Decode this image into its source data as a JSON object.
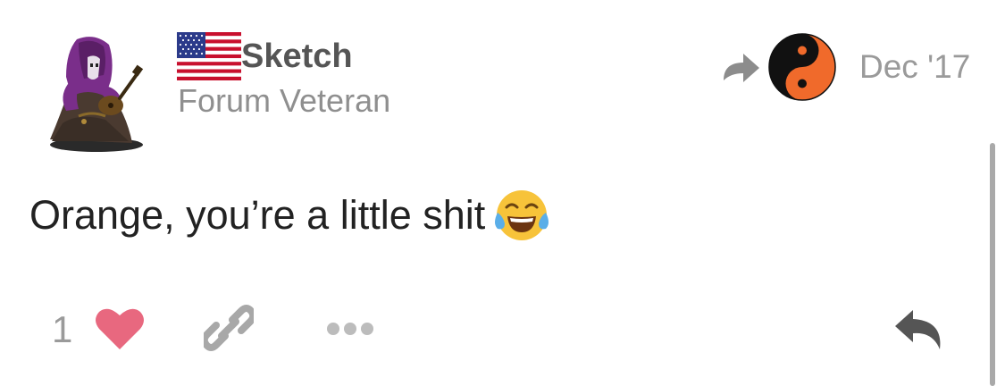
{
  "post": {
    "author": {
      "username": "Sketch",
      "title": "Forum Veteran",
      "flag_icon": "us-flag-icon",
      "avatar_icon": "hooded-bard-avatar"
    },
    "reply_to": {
      "arrow_icon": "reply-to-arrow-icon",
      "avatar_icon": "yin-yang-orange-avatar"
    },
    "date": "Dec '17",
    "body_text": "Orange, you’re a little shit",
    "body_emoji": "joy-emoji"
  },
  "actions": {
    "like_count": "1",
    "like_icon": "heart-icon",
    "link_icon": "link-icon",
    "more_icon": "ellipsis-icon",
    "reply_icon": "reply-icon"
  },
  "colors": {
    "heart": "#e8687f",
    "muted_icon": "#9a9a9a",
    "reply_icon": "#555555",
    "username": "#555555",
    "title": "#8f8f8f",
    "reply_to_avatar_orange": "#f06a2b"
  }
}
